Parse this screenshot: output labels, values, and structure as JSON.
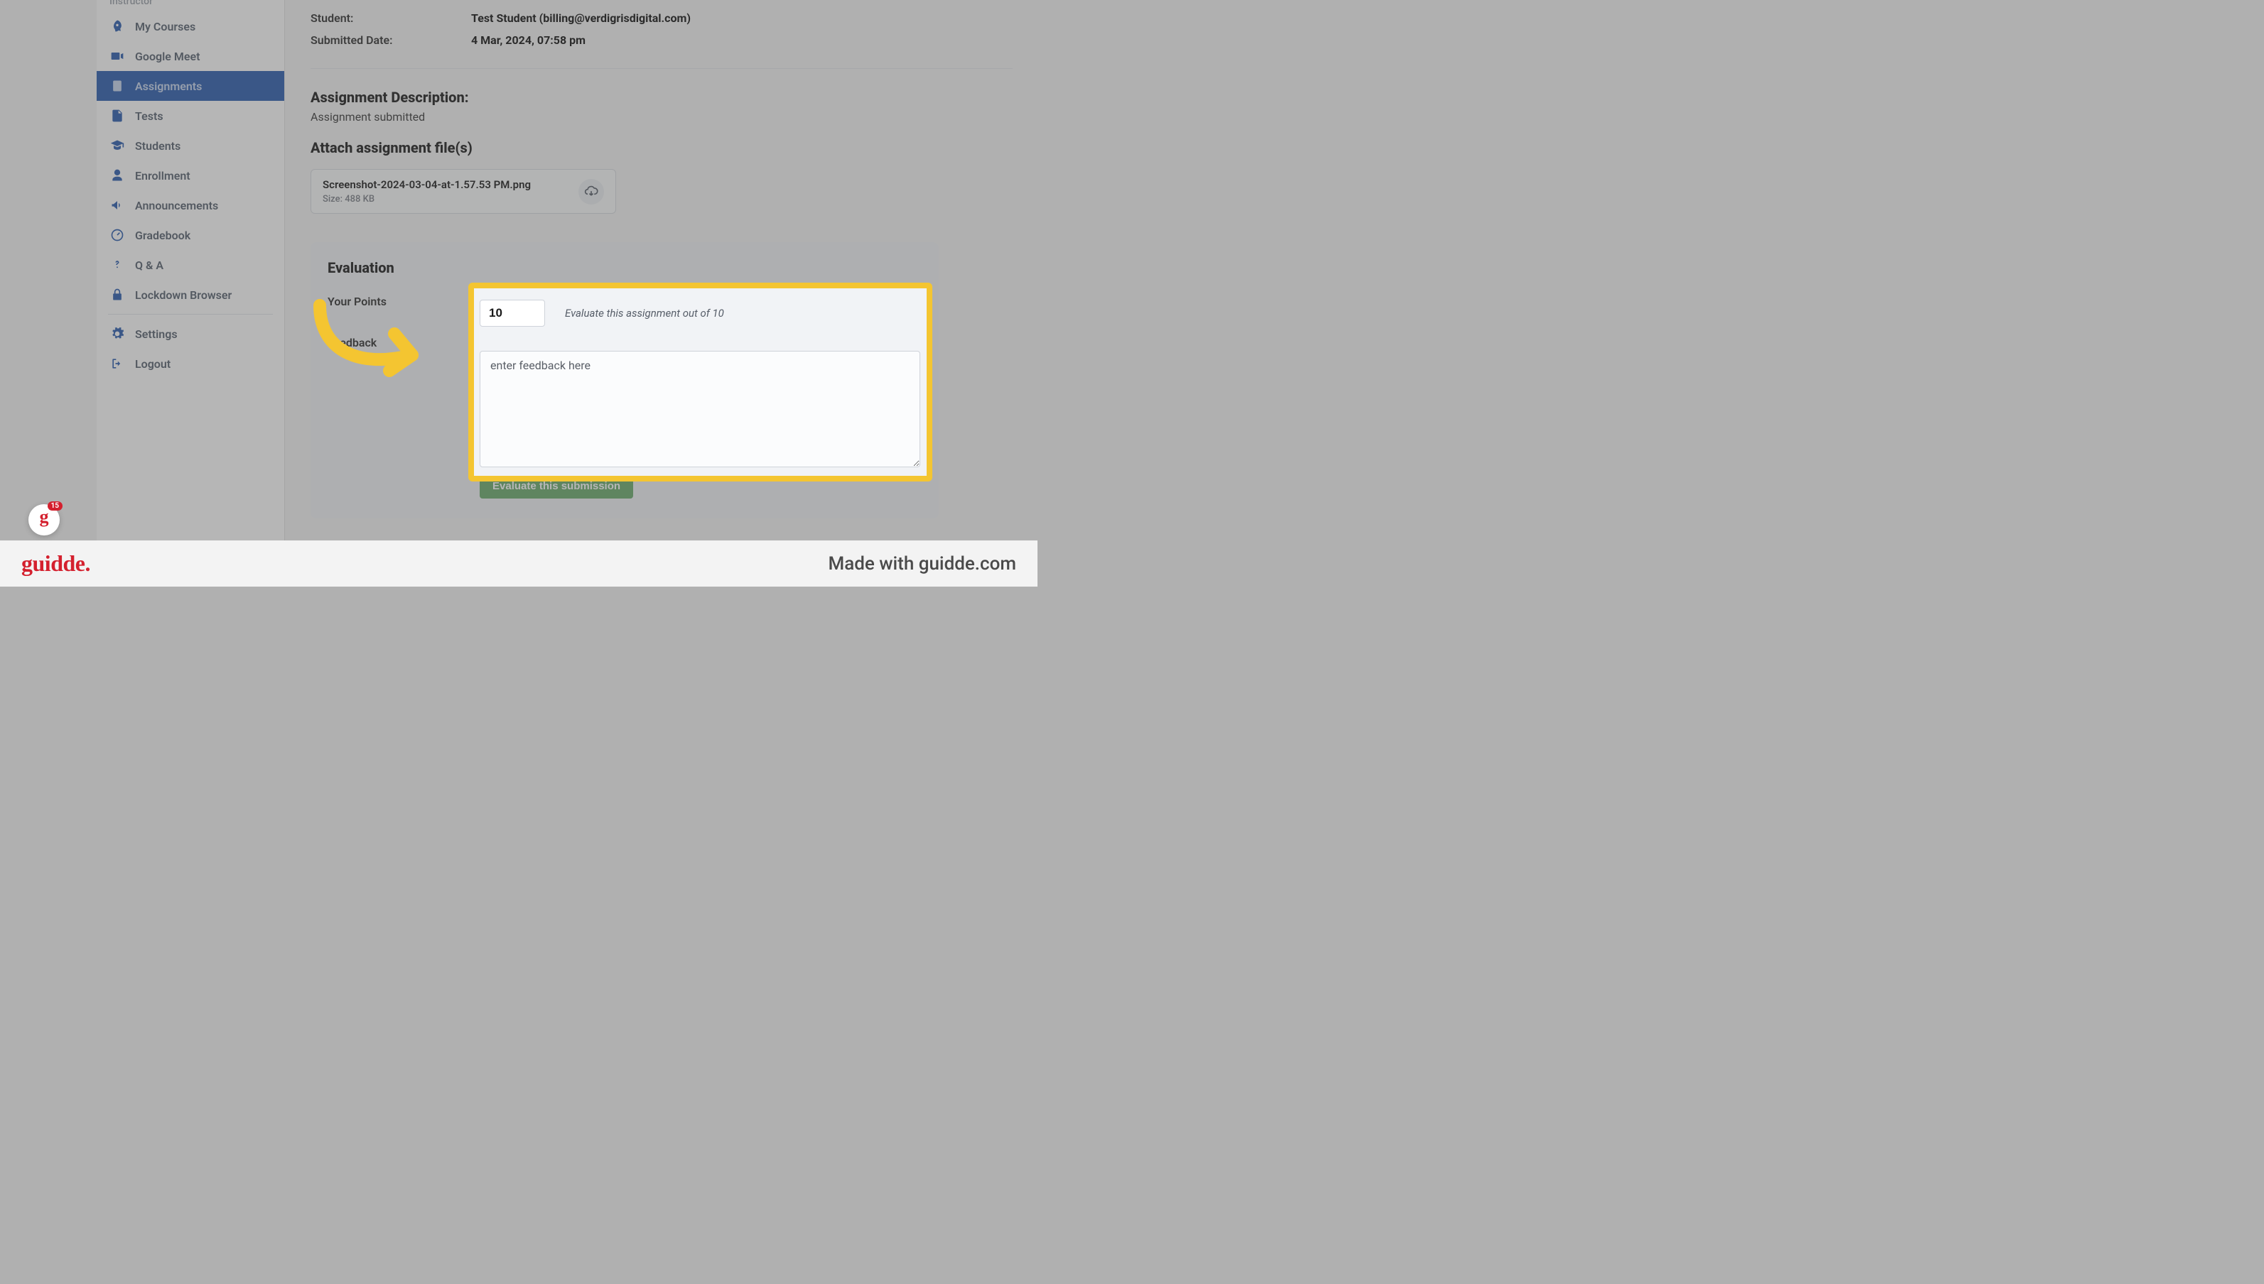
{
  "sidebar": {
    "section_label": "Instructor",
    "items": [
      {
        "label": "My Courses",
        "icon": "rocket-icon"
      },
      {
        "label": "Google Meet",
        "icon": "video-icon"
      },
      {
        "label": "Assignments",
        "icon": "clipboard-icon",
        "active": true
      },
      {
        "label": "Tests",
        "icon": "document-icon"
      },
      {
        "label": "Students",
        "icon": "graduation-cap-icon"
      },
      {
        "label": "Enrollment",
        "icon": "user-icon"
      },
      {
        "label": "Announcements",
        "icon": "megaphone-icon"
      },
      {
        "label": "Gradebook",
        "icon": "gauge-icon"
      },
      {
        "label": "Q & A",
        "icon": "question-icon"
      },
      {
        "label": "Lockdown Browser",
        "icon": "lock-icon"
      }
    ],
    "footer_items": [
      {
        "label": "Settings",
        "icon": "gear-icon"
      },
      {
        "label": "Logout",
        "icon": "logout-icon"
      }
    ]
  },
  "submission": {
    "student_label": "Student:",
    "student_value": "Test Student (billing@verdigrisdigital.com)",
    "date_label": "Submitted Date:",
    "date_value": "4 Mar, 2024, 07:58 pm"
  },
  "description": {
    "heading": "Assignment Description:",
    "text": "Assignment submitted"
  },
  "attach": {
    "heading": "Attach assignment file(s)",
    "file_name": "Screenshot-2024-03-04-at-1.57.53 PM.png",
    "file_size": "Size: 488 KB"
  },
  "evaluation": {
    "heading": "Evaluation",
    "points_label": "Your Points",
    "points_value": "10",
    "points_hint": "Evaluate this assignment out of 10",
    "feedback_label": "Feedback",
    "feedback_value": "enter feedback here",
    "submit_label": "Evaluate this submission"
  },
  "footer": {
    "logo": "guidde.",
    "made_with": "Made with guidde.com"
  },
  "badge": {
    "count": "15"
  }
}
